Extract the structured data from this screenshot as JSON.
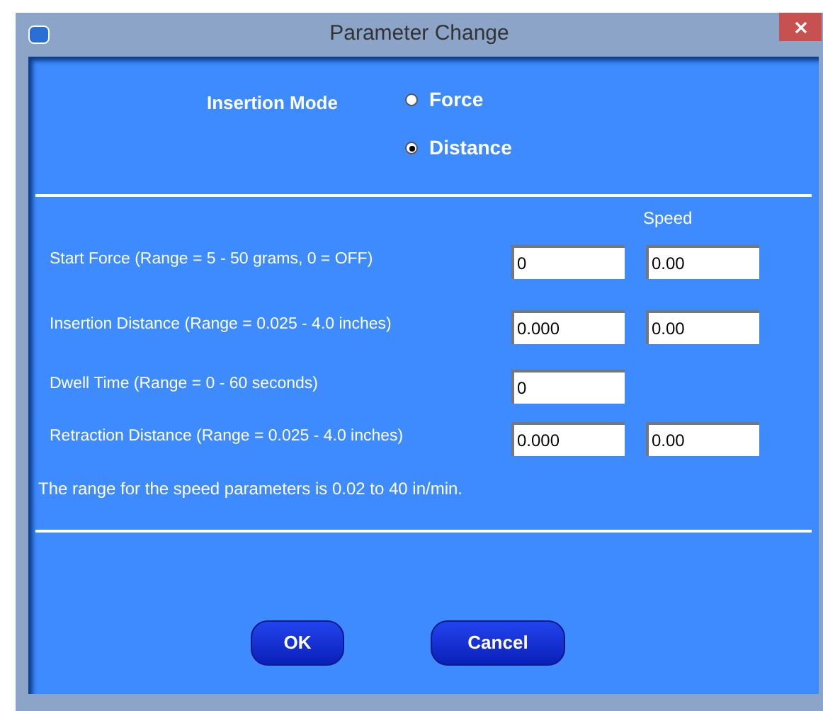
{
  "window": {
    "title": "Parameter Change"
  },
  "insertion_mode": {
    "label": "Insertion Mode",
    "options": [
      {
        "label": "Force",
        "selected": false
      },
      {
        "label": "Distance",
        "selected": true
      }
    ]
  },
  "speed_header": "Speed",
  "parameters": [
    {
      "label": "Start Force (Range = 5 - 50 grams, 0 = OFF)",
      "value": "0",
      "speed": "0.00"
    },
    {
      "label": "Insertion Distance (Range = 0.025 - 4.0 inches)",
      "value": "0.000",
      "speed": "0.00"
    },
    {
      "label": "Dwell Time (Range = 0 - 60 seconds)",
      "value": "0"
    },
    {
      "label": "Retraction Distance (Range = 0.025 - 4.0 inches)",
      "value": "0.000",
      "speed": "0.00"
    }
  ],
  "note": "The range for the speed parameters is 0.02 to 40 in/min.",
  "buttons": [
    "OK",
    "Cancel"
  ]
}
